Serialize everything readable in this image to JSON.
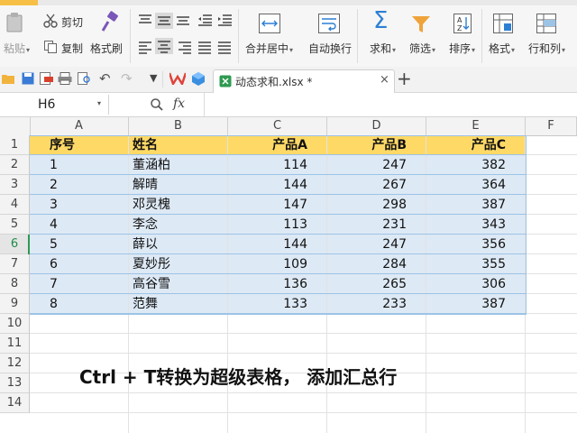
{
  "ribbon": {
    "cut": "剪切",
    "paste": "粘贴",
    "copy": "复制",
    "format_painter": "格式刷",
    "merge_center": "合并居中",
    "wrap_text": "自动换行",
    "sum": "求和",
    "filter": "筛选",
    "sort": "排序",
    "format": "格式",
    "rows_cols": "行和列"
  },
  "tab": {
    "filename": "动态求和.xlsx *",
    "close": "×",
    "new": "+"
  },
  "formula_bar": {
    "cell_ref": "H6",
    "fx": "fx"
  },
  "columns": [
    "A",
    "B",
    "C",
    "D",
    "E",
    "F"
  ],
  "rows": [
    "1",
    "2",
    "3",
    "4",
    "5",
    "6",
    "7",
    "8",
    "9",
    "10",
    "11",
    "12",
    "13",
    "14"
  ],
  "table": {
    "headers": [
      "序号",
      "姓名",
      "产品A",
      "产品B",
      "产品C"
    ],
    "records": [
      [
        "1",
        "董涵柏",
        "114",
        "247",
        "382"
      ],
      [
        "2",
        "解晴",
        "144",
        "267",
        "364"
      ],
      [
        "3",
        "邓灵槐",
        "147",
        "298",
        "387"
      ],
      [
        "4",
        "李念",
        "113",
        "231",
        "343"
      ],
      [
        "5",
        "薛以",
        "144",
        "247",
        "356"
      ],
      [
        "6",
        "夏妙彤",
        "109",
        "284",
        "355"
      ],
      [
        "7",
        "高谷雪",
        "136",
        "265",
        "306"
      ],
      [
        "8",
        "范舞",
        "133",
        "233",
        "387"
      ]
    ]
  },
  "caption": "Ctrl + T转换为超级表格， 添加汇总行",
  "colors": {
    "header_fill": "#ffd966",
    "band_fill": "#dde9f5",
    "band_border": "#9dc3e6",
    "accent": "#f6c046"
  }
}
